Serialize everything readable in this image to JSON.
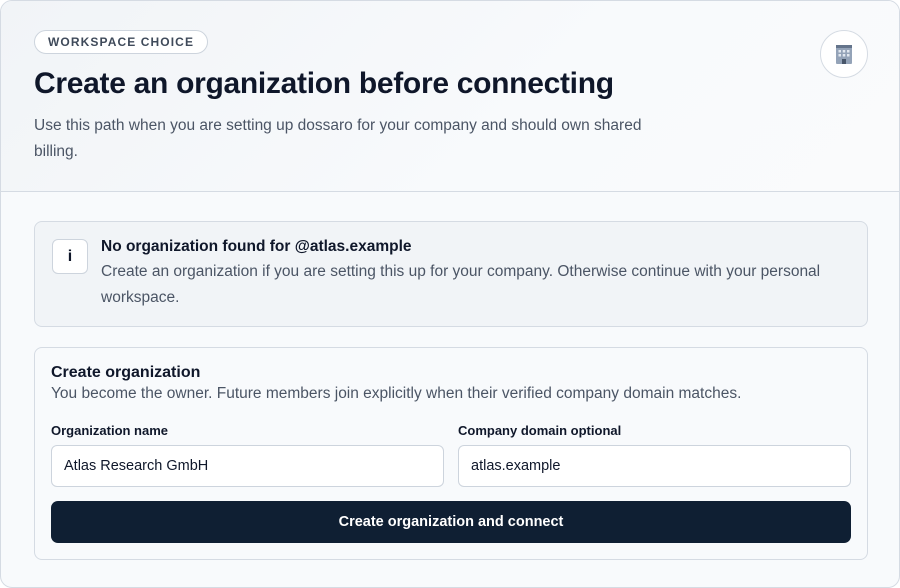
{
  "header": {
    "eyebrow": "WORKSPACE CHOICE",
    "title": "Create an organization before connecting",
    "subtitle": "Use this path when you are setting up dossaro for your company and should own shared billing.",
    "icon": "building-icon"
  },
  "notice": {
    "icon_glyph": "i",
    "title": "No organization found for @atlas.example",
    "body": "Create an organization if you are setting this up for your company. Otherwise continue with your personal workspace."
  },
  "form": {
    "title": "Create organization",
    "subtitle": "You become the owner. Future members join explicitly when their verified company domain matches.",
    "org_name": {
      "label": "Organization name",
      "value": "Atlas Research GmbH"
    },
    "domain": {
      "label": "Company domain optional",
      "value": "atlas.example"
    },
    "submit_label": "Create organization and connect"
  },
  "colors": {
    "primary_button": "#0f1f33",
    "text_primary": "#0f172a",
    "text_muted": "#4b5565",
    "border": "#d5dbe3"
  }
}
